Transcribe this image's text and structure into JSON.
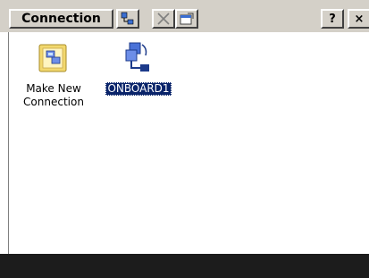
{
  "toolbar": {
    "menu_label": "Connection",
    "help_label": "?",
    "close_label": "×"
  },
  "items": [
    {
      "label": "Make New\nConnection",
      "icon": "make-new-connection-icon",
      "selected": false
    },
    {
      "label": "ONBOARD1",
      "icon": "dialup-connection-icon",
      "selected": true
    }
  ],
  "colors": {
    "chrome": "#d4d0c8",
    "selection": "#0a246a",
    "taskbar": "#1c1c1c"
  }
}
